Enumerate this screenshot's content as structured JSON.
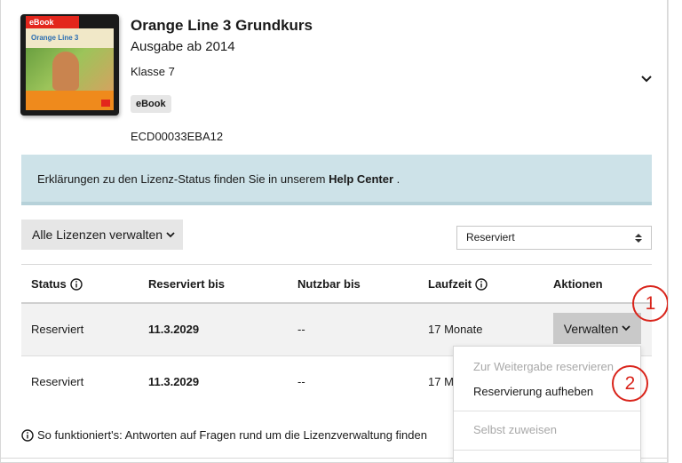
{
  "product": {
    "title": "Orange Line 3 Grundkurs",
    "edition": "Ausgabe ab 2014",
    "class": "Klasse 7",
    "badge": "eBook",
    "code": "ECD00033EBA12",
    "cover": {
      "tag": "eBook",
      "title": "Orange Line 3"
    }
  },
  "info_banner": {
    "text": "Erklärungen zu den Lizenz-Status finden Sie in unserem ",
    "link": "Help Center",
    "suffix": " ."
  },
  "controls": {
    "manage_all_label": "Alle Lizenzen verwalten",
    "filter_value": "Reserviert"
  },
  "table": {
    "headers": {
      "status": "Status",
      "reserved_until": "Reserviert bis",
      "usable_until": "Nutzbar bis",
      "duration": "Laufzeit",
      "actions": "Aktionen"
    },
    "rows": [
      {
        "status": "Reserviert",
        "reserved_until": "11.3.2029",
        "usable_until": "--",
        "duration": "17 Monate",
        "action": "Verwalten"
      },
      {
        "status": "Reserviert",
        "reserved_until": "11.3.2029",
        "usable_until": "--",
        "duration": "17 M"
      }
    ]
  },
  "dropdown": {
    "items": [
      {
        "label": "Zur Weitergabe reservieren",
        "disabled": true
      },
      {
        "label": "Reservierung aufheben",
        "disabled": false
      },
      {
        "label": "Selbst zuweisen",
        "disabled": true
      }
    ]
  },
  "callouts": [
    "1",
    "2"
  ],
  "footer": {
    "text": "So funktioniert's: Antworten auf Fragen rund um die Lizenzverwaltung finden"
  },
  "colors": {
    "banner_bg": "#cde2e8",
    "button_bg": "#e6e6e6",
    "active_button_bg": "#c9c9c9",
    "callout": "#d9241b",
    "disabled_text": "#a8a8a8",
    "cover_accent": "#e3261c",
    "cover_band": "#ef8a1c"
  },
  "icons": {
    "info": "info-circle-icon",
    "chevron": "chevron-down-icon",
    "select": "select-arrows-icon"
  }
}
